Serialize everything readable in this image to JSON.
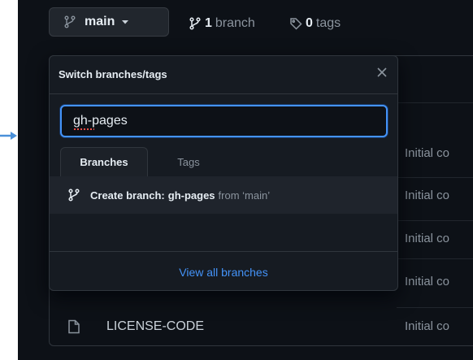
{
  "top_bar": {
    "branch_name": "main",
    "branch_count": "1",
    "branch_label": "branch",
    "tag_count": "0",
    "tag_label": "tags"
  },
  "dropdown": {
    "title": "Switch branches/tags",
    "search_value": "gh-pages",
    "tabs": [
      {
        "label": "Branches",
        "active": true
      },
      {
        "label": "Tags",
        "active": false
      }
    ],
    "create_prefix": "Create branch:",
    "create_branch": "gh-pages",
    "create_from": "from ‘main’",
    "footer_link": "View all branches"
  },
  "file_list": {
    "commit_messages": [
      "Initial co",
      "Initial co",
      "Initial co",
      "Initial co",
      "Initial co"
    ],
    "files": [
      {
        "name": "LICENSE-CODE",
        "commit": "Initial co"
      }
    ]
  },
  "colors": {
    "background": "#0d1117",
    "accent": "#4493f8",
    "pointer": "#4a90d9"
  }
}
